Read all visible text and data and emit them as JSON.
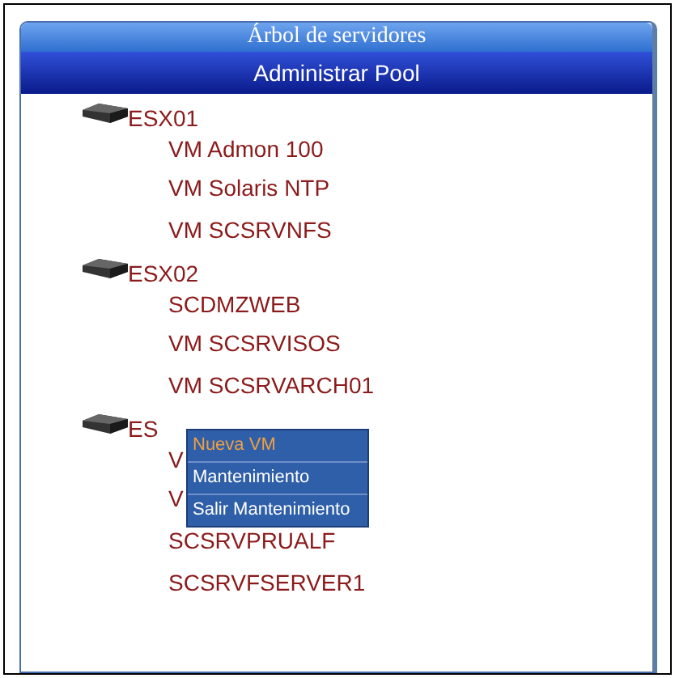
{
  "panel": {
    "title": "Árbol de servidores",
    "subtitle": "Administrar Pool"
  },
  "servers": [
    {
      "name": "ESX01",
      "children": [
        {
          "name": "VM Admon 100"
        },
        {
          "name": "VM Solaris NTP"
        },
        {
          "name": "VM SCSRVNFS"
        }
      ]
    },
    {
      "name": "ESX02",
      "children": [
        {
          "name": "SCDMZWEB"
        },
        {
          "name": "VM SCSRVISOS"
        },
        {
          "name": "VM SCSRVARCH01"
        }
      ]
    },
    {
      "name": "ES",
      "children": [
        {
          "name": "V"
        },
        {
          "name": "V"
        },
        {
          "name": "SCSRVPRUALF"
        },
        {
          "name": "SCSRVFSERVER1"
        }
      ]
    }
  ],
  "context_menu": [
    {
      "label": "Nueva VM",
      "selected": true
    },
    {
      "label": "Mantenimiento",
      "selected": false
    },
    {
      "label": "Salir Mantenimiento",
      "selected": false
    }
  ]
}
